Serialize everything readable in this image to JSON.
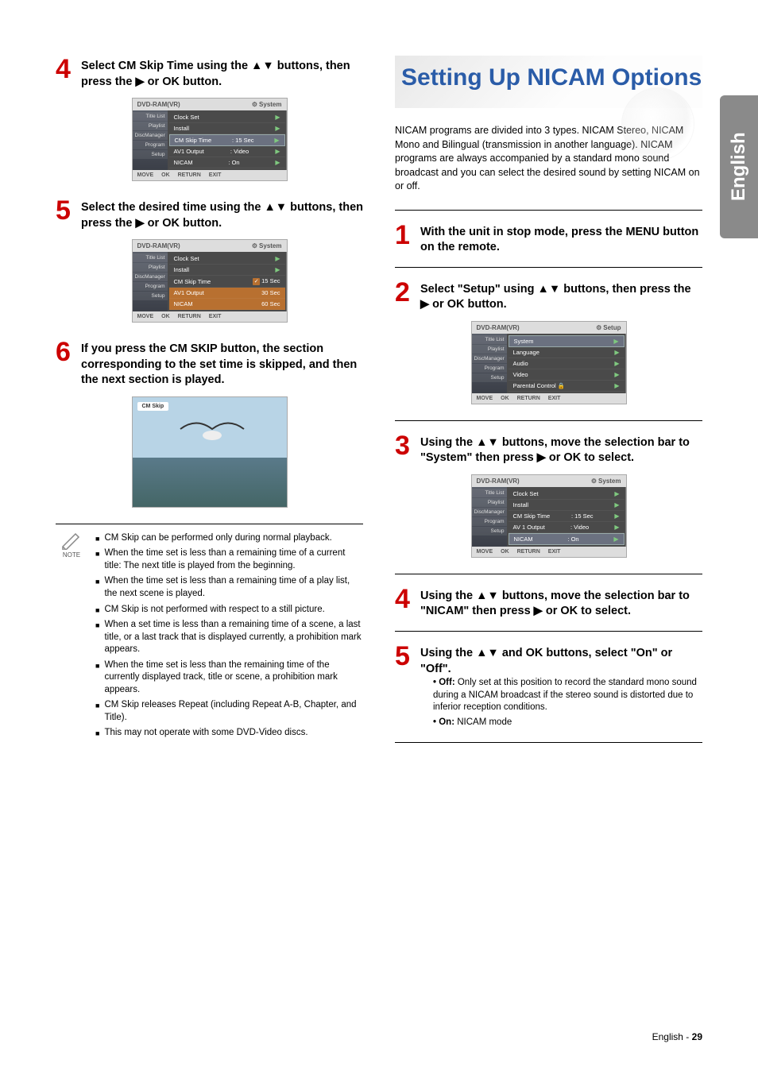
{
  "sideTab": "English",
  "pageFooter": {
    "lang": "English - ",
    "num": "29"
  },
  "left": {
    "step4": {
      "num": "4",
      "text": "Select CM Skip Time using the ▲▼ buttons, then press the ▶ or OK button."
    },
    "osd1": {
      "headerLeft": "DVD-RAM(VR)",
      "headerRight": "System",
      "side": [
        "Title List",
        "Playlist",
        "DiscManager",
        "Program",
        "Setup"
      ],
      "rows": [
        {
          "label": "Clock Set",
          "val": "",
          "arrow": true,
          "cls": ""
        },
        {
          "label": "Install",
          "val": "",
          "arrow": true,
          "cls": ""
        },
        {
          "label": "CM Skip Time",
          "val": ": 15 Sec",
          "arrow": true,
          "cls": "highlight"
        },
        {
          "label": "AV1 Output",
          "val": ": Video",
          "arrow": true,
          "cls": ""
        },
        {
          "label": "NICAM",
          "val": ": On",
          "arrow": true,
          "cls": ""
        }
      ],
      "footer": [
        "MOVE",
        "OK",
        "RETURN",
        "EXIT"
      ]
    },
    "step5": {
      "num": "5",
      "text": "Select the desired time using the ▲▼ buttons, then press the ▶ or OK button."
    },
    "osd2": {
      "headerLeft": "DVD-RAM(VR)",
      "headerRight": "System",
      "side": [
        "Title List",
        "Playlist",
        "DiscManager",
        "Program",
        "Setup"
      ],
      "rows": [
        {
          "label": "Clock Set",
          "val": "",
          "arrow": true,
          "cls": ""
        },
        {
          "label": "Install",
          "val": "",
          "arrow": true,
          "cls": ""
        },
        {
          "label": "CM Skip Time",
          "val": "15 Sec",
          "arrow": false,
          "cls": "dim",
          "check": true
        },
        {
          "label": "AV1 Output",
          "val": "30 Sec",
          "arrow": false,
          "cls": "orange"
        },
        {
          "label": "NICAM",
          "val": "60 Sec",
          "arrow": false,
          "cls": "orange"
        }
      ],
      "footer": [
        "MOVE",
        "OK",
        "RETURN",
        "EXIT"
      ]
    },
    "step6": {
      "num": "6",
      "text": "If you press the CM SKIP button, the section corresponding to the set time is skipped, and then the next section is played."
    },
    "cmskipLabel": "CM Skip",
    "noteLabel": "NOTE",
    "notes": [
      "CM Skip can be performed only during normal playback.",
      "When the time set is less than a remaining time of a current title: The next title is played from the beginning.",
      "When the time set is less than a remaining time of a play list, the next scene is played.",
      "CM Skip is not performed with respect to a still picture.",
      "When a set time is less than a remaining time of a scene, a last title, or a last track that is displayed currently, a prohibition mark appears.",
      "When the time set is less than the remaining time of the currently displayed track, title or scene, a prohibition mark appears.",
      "CM Skip releases Repeat (including Repeat A-B, Chapter, and Title).",
      "This may not operate with some DVD-Video discs."
    ]
  },
  "right": {
    "title": "Setting Up NICAM Options",
    "intro": "NICAM programs are divided into 3 types. NICAM Stereo, NICAM Mono and Bilingual (transmission in another language). NICAM programs are always accompanied by a standard mono sound broadcast and you can select the desired sound by setting NICAM on or off.",
    "step1": {
      "num": "1",
      "text": "With the unit in stop mode, press the MENU button on the remote."
    },
    "step2": {
      "num": "2",
      "text": "Select \"Setup\" using ▲▼ buttons, then press the ▶ or OK button."
    },
    "osd3": {
      "headerLeft": "DVD-RAM(VR)",
      "headerRight": "Setup",
      "side": [
        "Title List",
        "Playlist",
        "DiscManager",
        "Program",
        "Setup"
      ],
      "rows": [
        {
          "label": "System",
          "val": "",
          "arrow": true,
          "cls": "highlight"
        },
        {
          "label": "Language",
          "val": "",
          "arrow": true,
          "cls": ""
        },
        {
          "label": "Audio",
          "val": "",
          "arrow": true,
          "cls": ""
        },
        {
          "label": "Video",
          "val": "",
          "arrow": true,
          "cls": ""
        },
        {
          "label": "Parental Control 🔒",
          "val": "",
          "arrow": true,
          "cls": ""
        }
      ],
      "footer": [
        "MOVE",
        "OK",
        "RETURN",
        "EXIT"
      ]
    },
    "step3": {
      "num": "3",
      "text": "Using the ▲▼ buttons, move the selection bar to \"System\" then press ▶ or OK to select."
    },
    "osd4": {
      "headerLeft": "DVD-RAM(VR)",
      "headerRight": "System",
      "side": [
        "Title List",
        "Playlist",
        "DiscManager",
        "Program",
        "Setup"
      ],
      "rows": [
        {
          "label": "Clock Set",
          "val": "",
          "arrow": true,
          "cls": ""
        },
        {
          "label": "Install",
          "val": "",
          "arrow": true,
          "cls": ""
        },
        {
          "label": "CM Skip Time",
          "val": ": 15 Sec",
          "arrow": true,
          "cls": ""
        },
        {
          "label": "AV 1 Output",
          "val": ": Video",
          "arrow": true,
          "cls": ""
        },
        {
          "label": "NICAM",
          "val": ": On",
          "arrow": true,
          "cls": "highlight"
        }
      ],
      "footer": [
        "MOVE",
        "OK",
        "RETURN",
        "EXIT"
      ]
    },
    "step4": {
      "num": "4",
      "text": "Using the ▲▼ buttons, move the selection bar to \"NICAM\" then press ▶ or OK to select."
    },
    "step5": {
      "num": "5",
      "text": "Using the ▲▼ and OK buttons, select \"On\" or \"Off\".",
      "bullets": [
        {
          "b": "• Off:",
          "t": " Only set at this position to record the standard mono sound during a NICAM broadcast if the stereo sound is distorted due to inferior reception conditions."
        },
        {
          "b": "• On:",
          "t": " NICAM mode"
        }
      ]
    }
  }
}
